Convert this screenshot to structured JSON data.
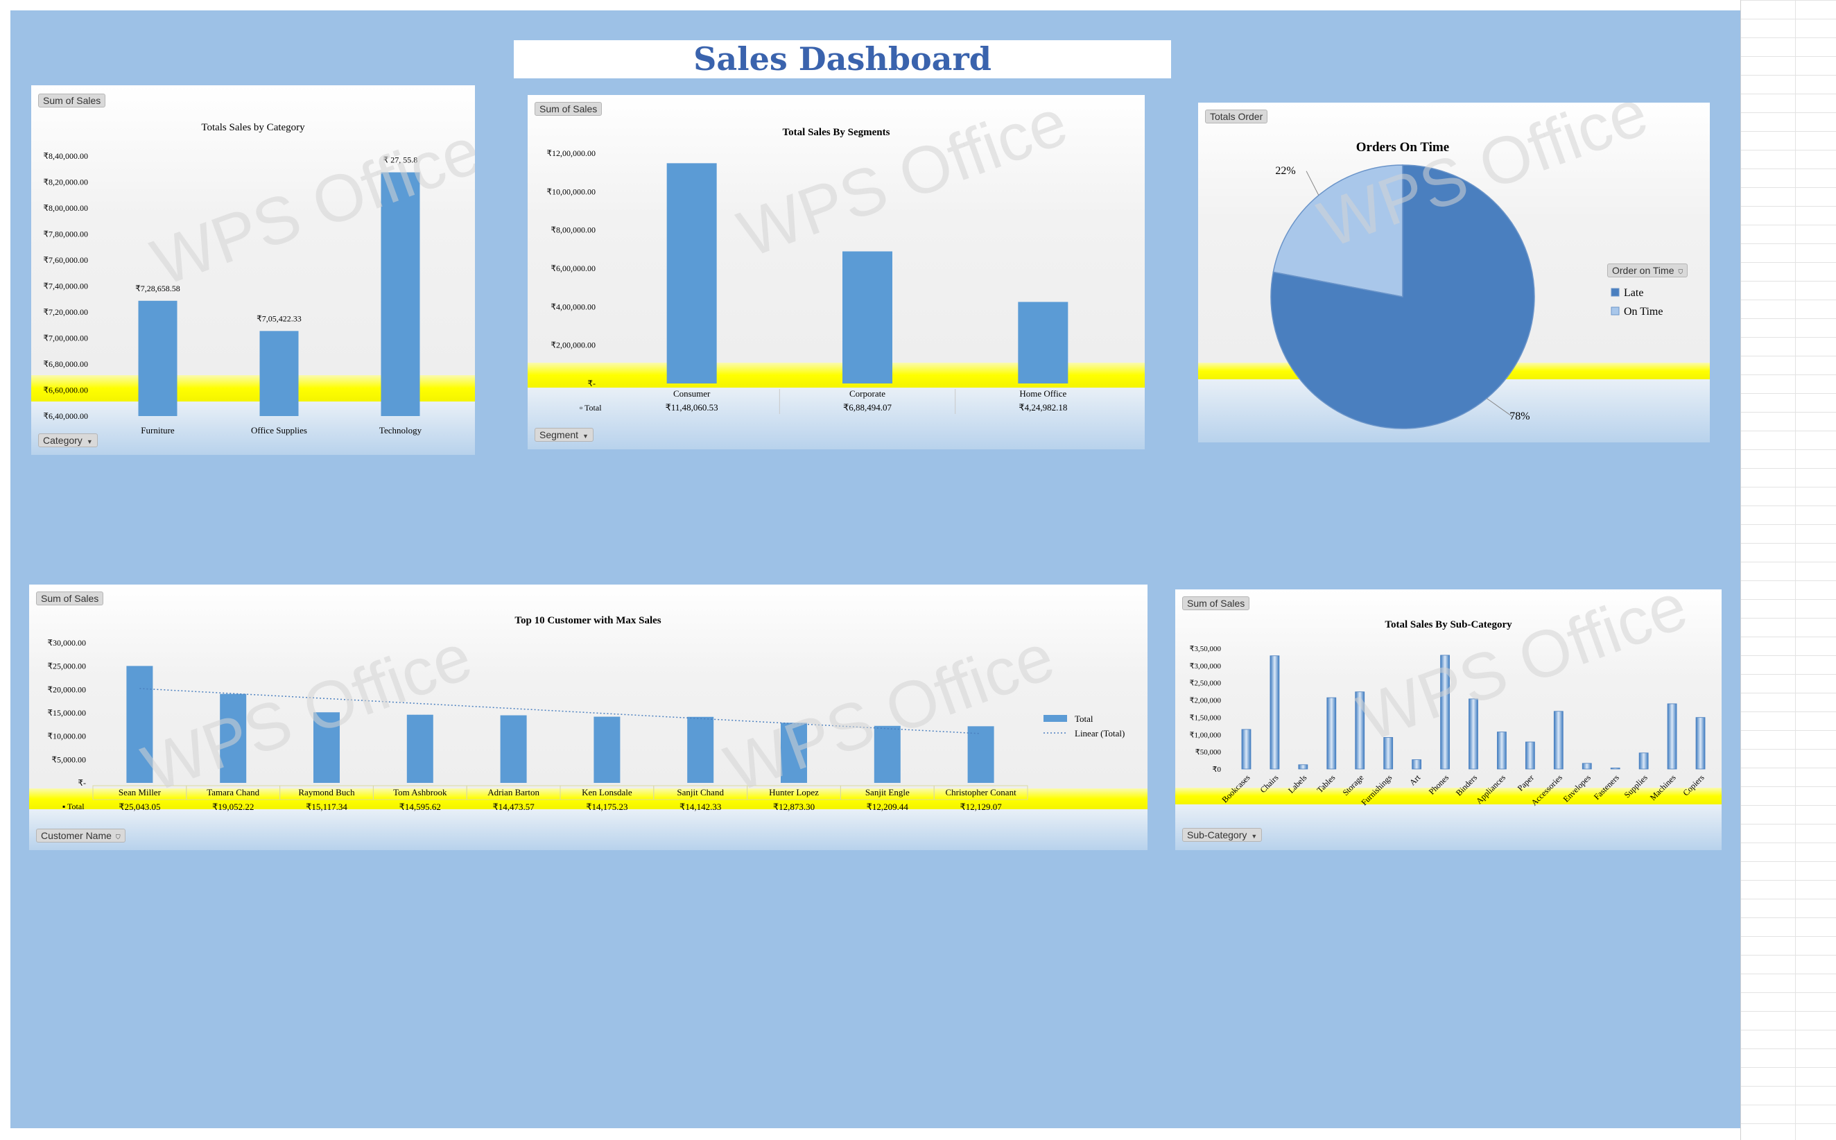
{
  "dashboard": {
    "title": "Sales Dashboard",
    "watermark": "WPS Office",
    "colors": {
      "background": "#9dc1e6",
      "bar": "#5b9bd5",
      "highlight": "#ffff00",
      "title": "#3a63ad"
    }
  },
  "charts": {
    "category": {
      "field_button": "Sum of Sales",
      "axis_button": "Category",
      "chart_data": {
        "type": "bar",
        "title": "Totals Sales by Category",
        "categories": [
          "Furniture",
          "Office Supplies",
          "Technology"
        ],
        "values": [
          728658.58,
          705422.33,
          827455.8
        ],
        "data_labels": [
          "₹7,28,658.58",
          "₹7,05,422.33",
          "₹   27,  55.8"
        ],
        "ylim": [
          640000,
          840000
        ],
        "yticks": [
          "₹8,40,000.00",
          "₹8,20,000.00",
          "₹8,00,000.00",
          "₹7,80,000.00",
          "₹7,60,000.00",
          "₹7,40,000.00",
          "₹7,20,000.00",
          "₹7,00,000.00",
          "₹6,80,000.00",
          "₹6,60,000.00",
          "₹6,40,000.00"
        ]
      }
    },
    "segments": {
      "field_button": "Sum of Sales",
      "axis_button": "Segment",
      "table_row_label": "Total",
      "chart_data": {
        "type": "bar",
        "title": "Total  Sales By Segments",
        "categories": [
          "Consumer",
          "Corporate",
          "Home Office"
        ],
        "values": [
          1148060.53,
          688494.07,
          424982.18
        ],
        "table_values": [
          "₹11,48,060.53",
          "₹6,88,494.07",
          "₹4,24,982.18"
        ],
        "ylim": [
          0,
          1200000
        ],
        "yticks": [
          "₹12,00,000.00",
          "₹10,00,000.00",
          "₹8,00,000.00",
          "₹6,00,000.00",
          "₹4,00,000.00",
          "₹2,00,000.00",
          "₹-"
        ]
      }
    },
    "orders": {
      "field_button": "Totals Order",
      "legend_button": "Order on Time",
      "chart_data": {
        "type": "pie",
        "title": "Orders On Time",
        "series": [
          {
            "name": "Late",
            "value": 78,
            "label": "78%",
            "color": "#4a7fbf"
          },
          {
            "name": "On Time",
            "value": 22,
            "label": "22%",
            "color": "#a9c7ea"
          }
        ],
        "legend": "right"
      }
    },
    "customers": {
      "field_button": "Sum of Sales",
      "axis_button": "Customer Name",
      "table_row_label": "Total",
      "chart_data": {
        "type": "bar",
        "title": "Top 10 Customer with Max Sales",
        "categories": [
          "Sean Miller",
          "Tamara Chand",
          "Raymond Buch",
          "Tom Ashbrook",
          "Adrian Barton",
          "Ken Lonsdale",
          "Sanjit Chand",
          "Hunter Lopez",
          "Sanjit Engle",
          "Christopher Conant"
        ],
        "axis_labels": [
          "Sean Miller",
          "Tamara Chand",
          "Raymond Buch",
          "Tom Ashbrook",
          "Adrian Barton",
          "Ken Lonsdale",
          "Sanjit Chand",
          "Hunter Lopez",
          "Sanjit Engle",
          "Christopher Conant"
        ],
        "values": [
          25043.05,
          19052.22,
          15117.34,
          14595.62,
          14473.57,
          14175.23,
          14142.33,
          12873.3,
          12209.44,
          12129.07
        ],
        "table_values": [
          "₹25,043.05",
          "₹19,052.22",
          "₹15,117.34",
          "₹14,595.62",
          "₹14,473.57",
          "₹14,175.23",
          "₹14,142.33",
          "₹12,873.30",
          "₹12,209.44",
          "₹12,129.07"
        ],
        "ylim": [
          0,
          30000
        ],
        "yticks": [
          "₹30,000.00",
          "₹25,000.00",
          "₹20,000.00",
          "₹15,000.00",
          "₹10,000.00",
          "₹5,000.00",
          "₹-"
        ],
        "legend": [
          "Total",
          "Linear (Total)"
        ],
        "trendline": true
      }
    },
    "subcategory": {
      "field_button": "Sum of Sales",
      "axis_button": "Sub-Category",
      "chart_data": {
        "type": "bar",
        "title": "Total Sales By Sub-Category",
        "categories": [
          "Bookcases",
          "Chairs",
          "Labels",
          "Tables",
          "Storage",
          "Furnishings",
          "Art",
          "Phones",
          "Binders",
          "Appliances",
          "Paper",
          "Accessories",
          "Envelopes",
          "Fasteners",
          "Supplies",
          "Machines",
          "Copiers"
        ],
        "values": [
          114880,
          328449,
          12486,
          206966,
          223844,
          91705,
          27119,
          330007,
          203413,
          107532,
          78479,
          167380,
          16476,
          3024,
          46674,
          189239,
          149528
        ],
        "ylim": [
          0,
          350000
        ],
        "yticks": [
          "₹3,50,000",
          "₹3,00,000",
          "₹2,50,000",
          "₹2,00,000",
          "₹1,50,000",
          "₹1,00,000",
          "₹50,000",
          "₹0"
        ]
      }
    }
  }
}
